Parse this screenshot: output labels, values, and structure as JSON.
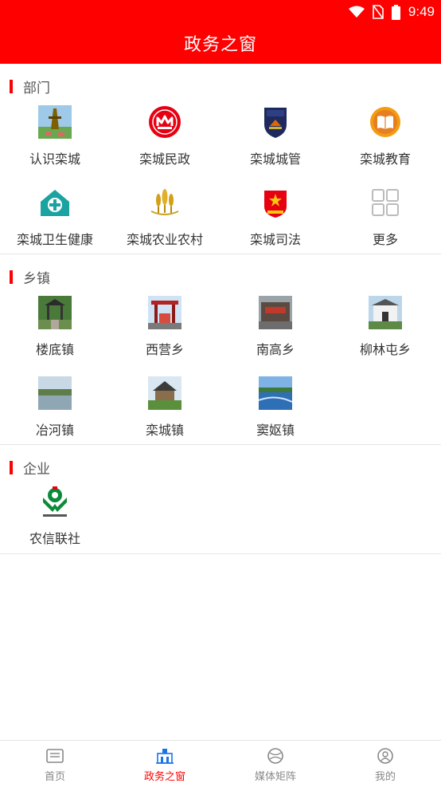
{
  "status_bar": {
    "time": "9:49"
  },
  "header": {
    "title": "政务之窗"
  },
  "sections": [
    {
      "title": "部门",
      "items": [
        {
          "label": "认识栾城",
          "icon": "photo-tower-icon"
        },
        {
          "label": "栾城民政",
          "icon": "civil-affairs-emblem-icon"
        },
        {
          "label": "栾城城管",
          "icon": "city-management-badge-icon"
        },
        {
          "label": "栾城教育",
          "icon": "book-icon"
        },
        {
          "label": "栾城卫生健康",
          "icon": "health-house-icon"
        },
        {
          "label": "栾城农业农村",
          "icon": "wheat-icon"
        },
        {
          "label": "栾城司法",
          "icon": "justice-emblem-icon"
        },
        {
          "label": "更多",
          "icon": "grid-more-icon"
        }
      ]
    },
    {
      "title": "乡镇",
      "items": [
        {
          "label": "楼底镇",
          "icon": "photo-pavilion-icon"
        },
        {
          "label": "西营乡",
          "icon": "photo-gate-icon"
        },
        {
          "label": "南高乡",
          "icon": "photo-wall-icon"
        },
        {
          "label": "柳林屯乡",
          "icon": "photo-building-icon"
        },
        {
          "label": "冶河镇",
          "icon": "photo-river-icon"
        },
        {
          "label": "栾城镇",
          "icon": "photo-house-icon"
        },
        {
          "label": "窦妪镇",
          "icon": "photo-lake-icon"
        }
      ]
    },
    {
      "title": "企业",
      "items": [
        {
          "label": "农信联社",
          "icon": "rural-credit-logo-icon"
        }
      ]
    }
  ],
  "tabs": [
    {
      "label": "首页",
      "icon": "home-news-icon",
      "active": false
    },
    {
      "label": "政务之窗",
      "icon": "government-building-icon",
      "active": true
    },
    {
      "label": "媒体矩阵",
      "icon": "globe-icon",
      "active": false
    },
    {
      "label": "我的",
      "icon": "user-icon",
      "active": false
    }
  ],
  "colors": {
    "primary": "#ff0000",
    "text": "#333333",
    "muted": "#888888"
  }
}
